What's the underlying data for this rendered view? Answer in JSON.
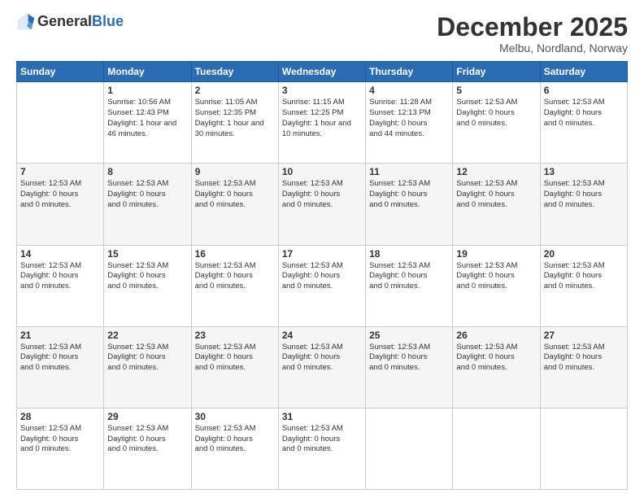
{
  "logo": {
    "general": "General",
    "blue": "Blue"
  },
  "header": {
    "month_year": "December 2025",
    "location": "Melbu, Nordland, Norway"
  },
  "days_of_week": [
    "Sunday",
    "Monday",
    "Tuesday",
    "Wednesday",
    "Thursday",
    "Friday",
    "Saturday"
  ],
  "weeks": [
    [
      {
        "day": "",
        "info": ""
      },
      {
        "day": "1",
        "info": "Sunrise: 10:56 AM\nSunset: 12:43 PM\nDaylight: 1 hour and\n46 minutes."
      },
      {
        "day": "2",
        "info": "Sunrise: 11:05 AM\nSunset: 12:35 PM\nDaylight: 1 hour and\n30 minutes."
      },
      {
        "day": "3",
        "info": "Sunrise: 11:15 AM\nSunset: 12:25 PM\nDaylight: 1 hour and\n10 minutes."
      },
      {
        "day": "4",
        "info": "Sunrise: 11:28 AM\nSunset: 12:13 PM\nDaylight: 0 hours\nand 44 minutes."
      },
      {
        "day": "5",
        "info": "Sunset: 12:53 AM\nDaylight: 0 hours\nand 0 minutes."
      },
      {
        "day": "6",
        "info": "Sunset: 12:53 AM\nDaylight: 0 hours\nand 0 minutes."
      }
    ],
    [
      {
        "day": "7",
        "info": "Sunset: 12:53 AM\nDaylight: 0 hours\nand 0 minutes."
      },
      {
        "day": "8",
        "info": "Sunset: 12:53 AM\nDaylight: 0 hours\nand 0 minutes."
      },
      {
        "day": "9",
        "info": "Sunset: 12:53 AM\nDaylight: 0 hours\nand 0 minutes."
      },
      {
        "day": "10",
        "info": "Sunset: 12:53 AM\nDaylight: 0 hours\nand 0 minutes."
      },
      {
        "day": "11",
        "info": "Sunset: 12:53 AM\nDaylight: 0 hours\nand 0 minutes."
      },
      {
        "day": "12",
        "info": "Sunset: 12:53 AM\nDaylight: 0 hours\nand 0 minutes."
      },
      {
        "day": "13",
        "info": "Sunset: 12:53 AM\nDaylight: 0 hours\nand 0 minutes."
      }
    ],
    [
      {
        "day": "14",
        "info": "Sunset: 12:53 AM\nDaylight: 0 hours\nand 0 minutes."
      },
      {
        "day": "15",
        "info": "Sunset: 12:53 AM\nDaylight: 0 hours\nand 0 minutes."
      },
      {
        "day": "16",
        "info": "Sunset: 12:53 AM\nDaylight: 0 hours\nand 0 minutes."
      },
      {
        "day": "17",
        "info": "Sunset: 12:53 AM\nDaylight: 0 hours\nand 0 minutes."
      },
      {
        "day": "18",
        "info": "Sunset: 12:53 AM\nDaylight: 0 hours\nand 0 minutes."
      },
      {
        "day": "19",
        "info": "Sunset: 12:53 AM\nDaylight: 0 hours\nand 0 minutes."
      },
      {
        "day": "20",
        "info": "Sunset: 12:53 AM\nDaylight: 0 hours\nand 0 minutes."
      }
    ],
    [
      {
        "day": "21",
        "info": "Sunset: 12:53 AM\nDaylight: 0 hours\nand 0 minutes."
      },
      {
        "day": "22",
        "info": "Sunset: 12:53 AM\nDaylight: 0 hours\nand 0 minutes."
      },
      {
        "day": "23",
        "info": "Sunset: 12:53 AM\nDaylight: 0 hours\nand 0 minutes."
      },
      {
        "day": "24",
        "info": "Sunset: 12:53 AM\nDaylight: 0 hours\nand 0 minutes."
      },
      {
        "day": "25",
        "info": "Sunset: 12:53 AM\nDaylight: 0 hours\nand 0 minutes."
      },
      {
        "day": "26",
        "info": "Sunset: 12:53 AM\nDaylight: 0 hours\nand 0 minutes."
      },
      {
        "day": "27",
        "info": "Sunset: 12:53 AM\nDaylight: 0 hours\nand 0 minutes."
      }
    ],
    [
      {
        "day": "28",
        "info": "Sunset: 12:53 AM\nDaylight: 0 hours\nand 0 minutes."
      },
      {
        "day": "29",
        "info": "Sunset: 12:53 AM\nDaylight: 0 hours\nand 0 minutes."
      },
      {
        "day": "30",
        "info": "Sunset: 12:53 AM\nDaylight: 0 hours\nand 0 minutes."
      },
      {
        "day": "31",
        "info": "Sunset: 12:53 AM\nDaylight: 0 hours\nand 0 minutes."
      },
      {
        "day": "",
        "info": ""
      },
      {
        "day": "",
        "info": ""
      },
      {
        "day": "",
        "info": ""
      }
    ]
  ]
}
